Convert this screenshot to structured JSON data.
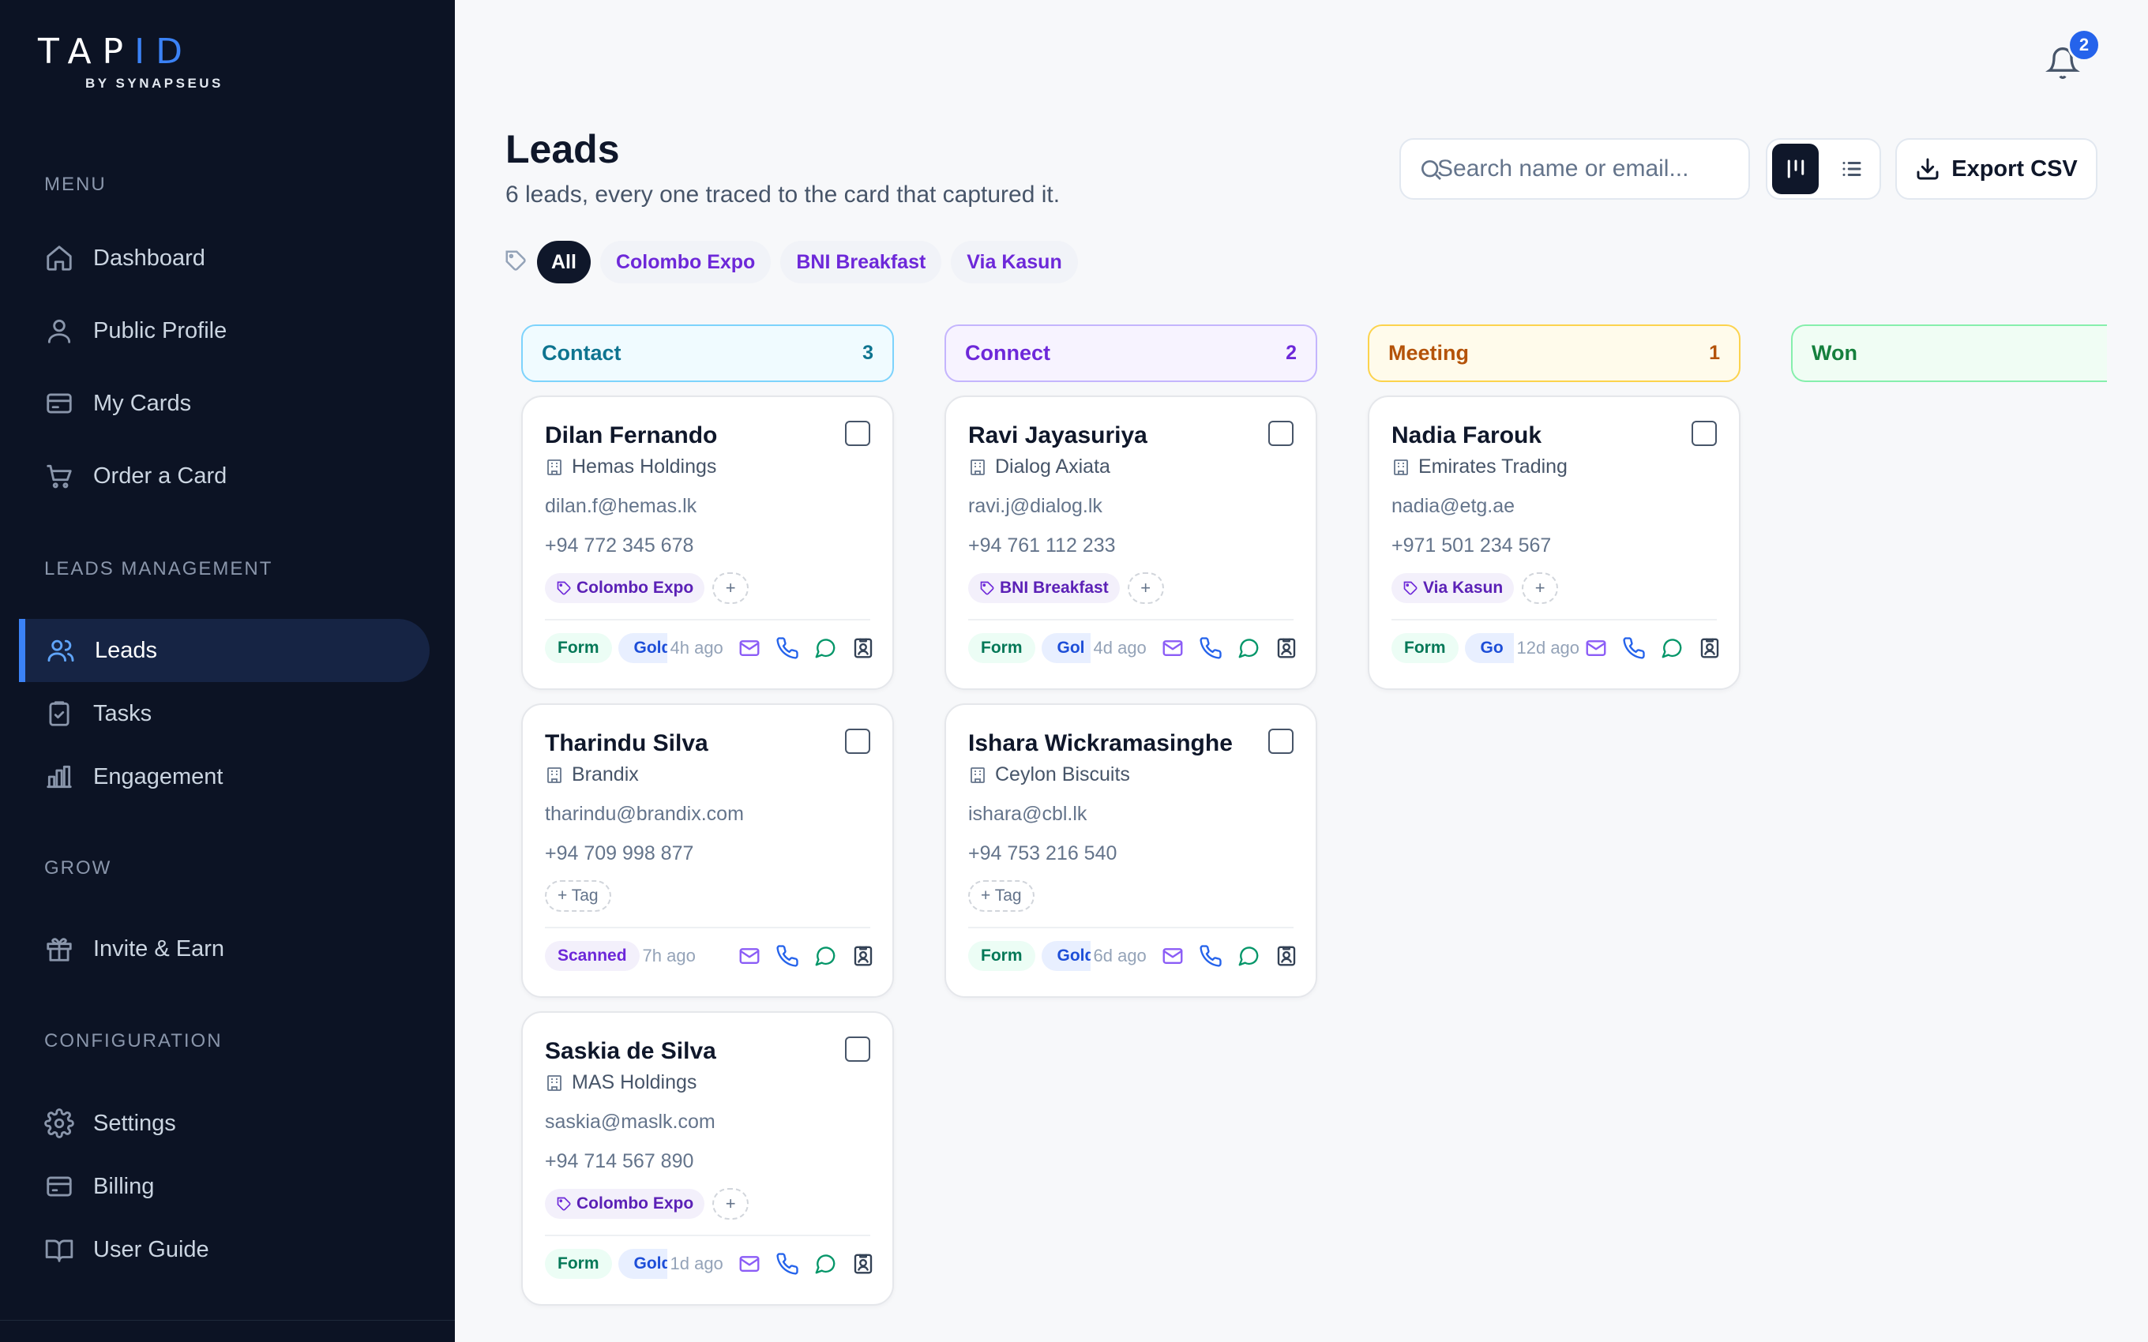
{
  "brand": {
    "word_main": "TAP",
    "word_accent": "ID",
    "sub": "BY SYNAPSEUS"
  },
  "sidebar": {
    "sections": [
      {
        "title": "MENU",
        "items": [
          {
            "label": "Dashboard",
            "icon": "home-icon"
          },
          {
            "label": "Public Profile",
            "icon": "user-icon"
          },
          {
            "label": "My Cards",
            "icon": "card-icon"
          },
          {
            "label": "Order a Card",
            "icon": "cart-icon"
          }
        ]
      },
      {
        "title": "LEADS MANAGEMENT",
        "items": [
          {
            "label": "Leads",
            "icon": "users-icon",
            "active": true
          },
          {
            "label": "Tasks",
            "icon": "clipboard-icon"
          },
          {
            "label": "Engagement",
            "icon": "bar-chart-icon"
          }
        ]
      },
      {
        "title": "GROW",
        "items": [
          {
            "label": "Invite & Earn",
            "icon": "gift-icon"
          }
        ]
      },
      {
        "title": "CONFIGURATION",
        "items": [
          {
            "label": "Settings",
            "icon": "gear-icon"
          },
          {
            "label": "Billing",
            "icon": "billing-icon"
          },
          {
            "label": "User Guide",
            "icon": "book-icon"
          }
        ]
      }
    ]
  },
  "header": {
    "notifications_count": "2"
  },
  "page": {
    "title": "Leads",
    "subtitle": "6 leads, every one traced to the card that captured it.",
    "search_placeholder": "Search name or email...",
    "export_label": "Export CSV",
    "view_mode": "board"
  },
  "filters": [
    "All",
    "Colombo Expo",
    "BNI Breakfast",
    "Via Kasun"
  ],
  "colors": {
    "accent": "#3b82f6",
    "sidebar_bg": "#0c1324",
    "tag_purple": "#6d28d9"
  },
  "columns": [
    {
      "name": "Contact",
      "count": "3",
      "cards": [
        {
          "name": "Dilan Fernando",
          "company": "Hemas Holdings",
          "email": "dilan.f@hemas.lk",
          "phone": "+94 772 345 678",
          "tag": "Colombo Expo",
          "source": "Form",
          "card": "Gold",
          "ago": "4h ago"
        },
        {
          "name": "Tharindu Silva",
          "company": "Brandix",
          "email": "tharindu@brandix.com",
          "phone": "+94 709 998 877",
          "tag": "",
          "add_tag_label": "+ Tag",
          "source": "Scanned",
          "card": "",
          "ago": "7h ago"
        },
        {
          "name": "Saskia de Silva",
          "company": "MAS Holdings",
          "email": "saskia@maslk.com",
          "phone": "+94 714 567 890",
          "tag": "Colombo Expo",
          "source": "Form",
          "card": "Gold",
          "ago": "1d ago"
        }
      ]
    },
    {
      "name": "Connect",
      "count": "2",
      "cards": [
        {
          "name": "Ravi Jayasuriya",
          "company": "Dialog Axiata",
          "email": "ravi.j@dialog.lk",
          "phone": "+94 761 112 233",
          "tag": "BNI Breakfast",
          "source": "Form",
          "card": "Gol",
          "ago": "4d ago"
        },
        {
          "name": "Ishara Wickramasinghe",
          "company": "Ceylon Biscuits",
          "email": "ishara@cbl.lk",
          "phone": "+94 753 216 540",
          "tag": "",
          "add_tag_label": "+ Tag",
          "source": "Form",
          "card": "Gold",
          "ago": "6d ago"
        }
      ]
    },
    {
      "name": "Meeting",
      "count": "1",
      "cards": [
        {
          "name": "Nadia Farouk",
          "company": "Emirates Trading",
          "email": "nadia@etg.ae",
          "phone": "+971 501 234 567",
          "tag": "Via Kasun",
          "source": "Form",
          "card": "Go",
          "ago": "12d ago"
        }
      ]
    },
    {
      "name": "Won",
      "count": "",
      "cards": []
    }
  ]
}
